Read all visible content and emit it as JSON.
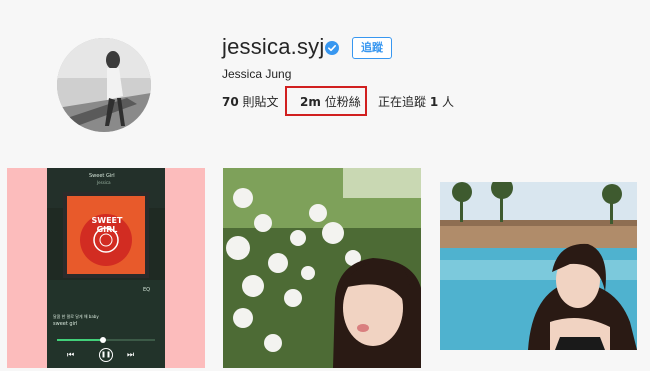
{
  "profile": {
    "username": "jessica.syj",
    "full_name": "Jessica Jung",
    "follow_label": "追蹤",
    "verified": true
  },
  "stats": {
    "posts_count": "70",
    "posts_label": "則貼文",
    "followers_count": "2m",
    "followers_label": "位粉絲",
    "following_prefix": "正在追蹤",
    "following_count": "1",
    "following_suffix": "人"
  },
  "posts": [
    {
      "type": "music-app-screenshot",
      "song_title": "Sweet Girl",
      "artist": "Jessica",
      "album_art_text": "SWEET GIRL",
      "lyric_line": "달콤 한 말로 달게 해 baby",
      "lyric_line2": "sweet girl",
      "eq_label": "EQ"
    },
    {
      "type": "selfie-with-flowers"
    },
    {
      "type": "pool-selfie"
    }
  ],
  "colors": {
    "accent": "#3897f0",
    "highlight": "#d11f1f",
    "tile1_bg": "#fcbcbc"
  }
}
